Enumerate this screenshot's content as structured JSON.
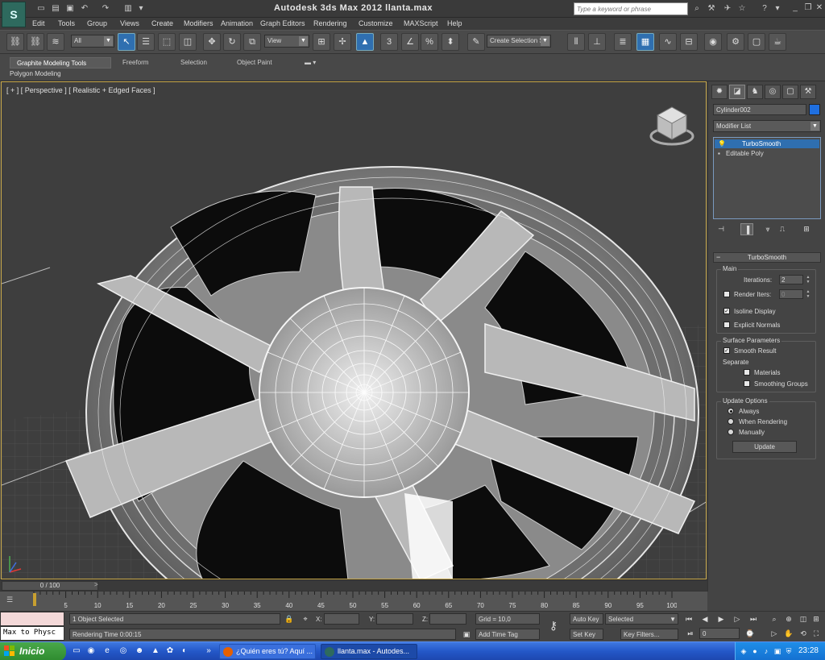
{
  "titlebar": {
    "logo": "S",
    "title": "Autodesk 3ds Max  2012      llanta.max",
    "search_placeholder": "Type a keyword or phrase"
  },
  "menu": [
    "Edit",
    "Tools",
    "Group",
    "Views",
    "Create",
    "Modifiers",
    "Animation",
    "Graph Editors",
    "Rendering",
    "Customize",
    "MAXScript",
    "Help"
  ],
  "toolbar": {
    "selection_filter": "All",
    "reference_coord": "View",
    "named_selection": "Create Selection Se",
    "snap_value": "3",
    "angle_snap": "∠",
    "percent_snap": "%"
  },
  "ribbon": {
    "tabs": [
      "Graphite Modeling Tools",
      "Freeform",
      "Selection",
      "Object Paint"
    ],
    "sub_label": "Polygon Modeling"
  },
  "viewport": {
    "label": "[ + ] [ Perspective ] [ Realistic + Edged Faces ]"
  },
  "command_panel": {
    "object_name": "Cylinder002",
    "object_color": "#1f6fe0",
    "modifier_list": "Modifier List",
    "stack": [
      "TurboSmooth",
      "Editable Poly"
    ],
    "rollout_title": "TurboSmooth",
    "main": {
      "label": "Main",
      "iterations_label": "Iterations:",
      "iterations_value": "2",
      "render_iters_label": "Render Iters:",
      "render_iters_value": "0",
      "isoline_display": "Isoline Display",
      "explicit_normals": "Explicit Normals"
    },
    "surface": {
      "label": "Surface Parameters",
      "smooth_result": "Smooth Result",
      "separate_label": "Separate",
      "materials": "Materials",
      "smoothing_groups": "Smoothing Groups"
    },
    "update_options": {
      "label": "Update Options",
      "always": "Always",
      "when_rendering": "When Rendering",
      "manually": "Manually",
      "update_button": "Update"
    }
  },
  "timeline": {
    "frame_display": "0 / 100",
    "ticks": [
      "5",
      "10",
      "15",
      "20",
      "25",
      "30",
      "35",
      "40",
      "45",
      "50",
      "55",
      "60",
      "65",
      "70",
      "75",
      "80",
      "85",
      "90",
      "95",
      "100"
    ]
  },
  "status": {
    "maxscript_label": "Max to Physc",
    "selection_status": "1 Object Selected",
    "rendering_time": "Rendering Time  0:00:15",
    "x_label": "X:",
    "y_label": "Y:",
    "z_label": "Z:",
    "grid": "Grid = 10,0",
    "add_time_tag": "Add Time Tag",
    "auto_key": "Auto Key",
    "set_key": "Set Key",
    "selected_dropdown": "Selected",
    "key_filters": "Key Filters...",
    "current_frame": "0"
  },
  "taskbar": {
    "start": "Inicio",
    "tasks": [
      "¿Quién eres tú? Aquí ...",
      "llanta.max - Autodes..."
    ],
    "clock": "23:28"
  }
}
